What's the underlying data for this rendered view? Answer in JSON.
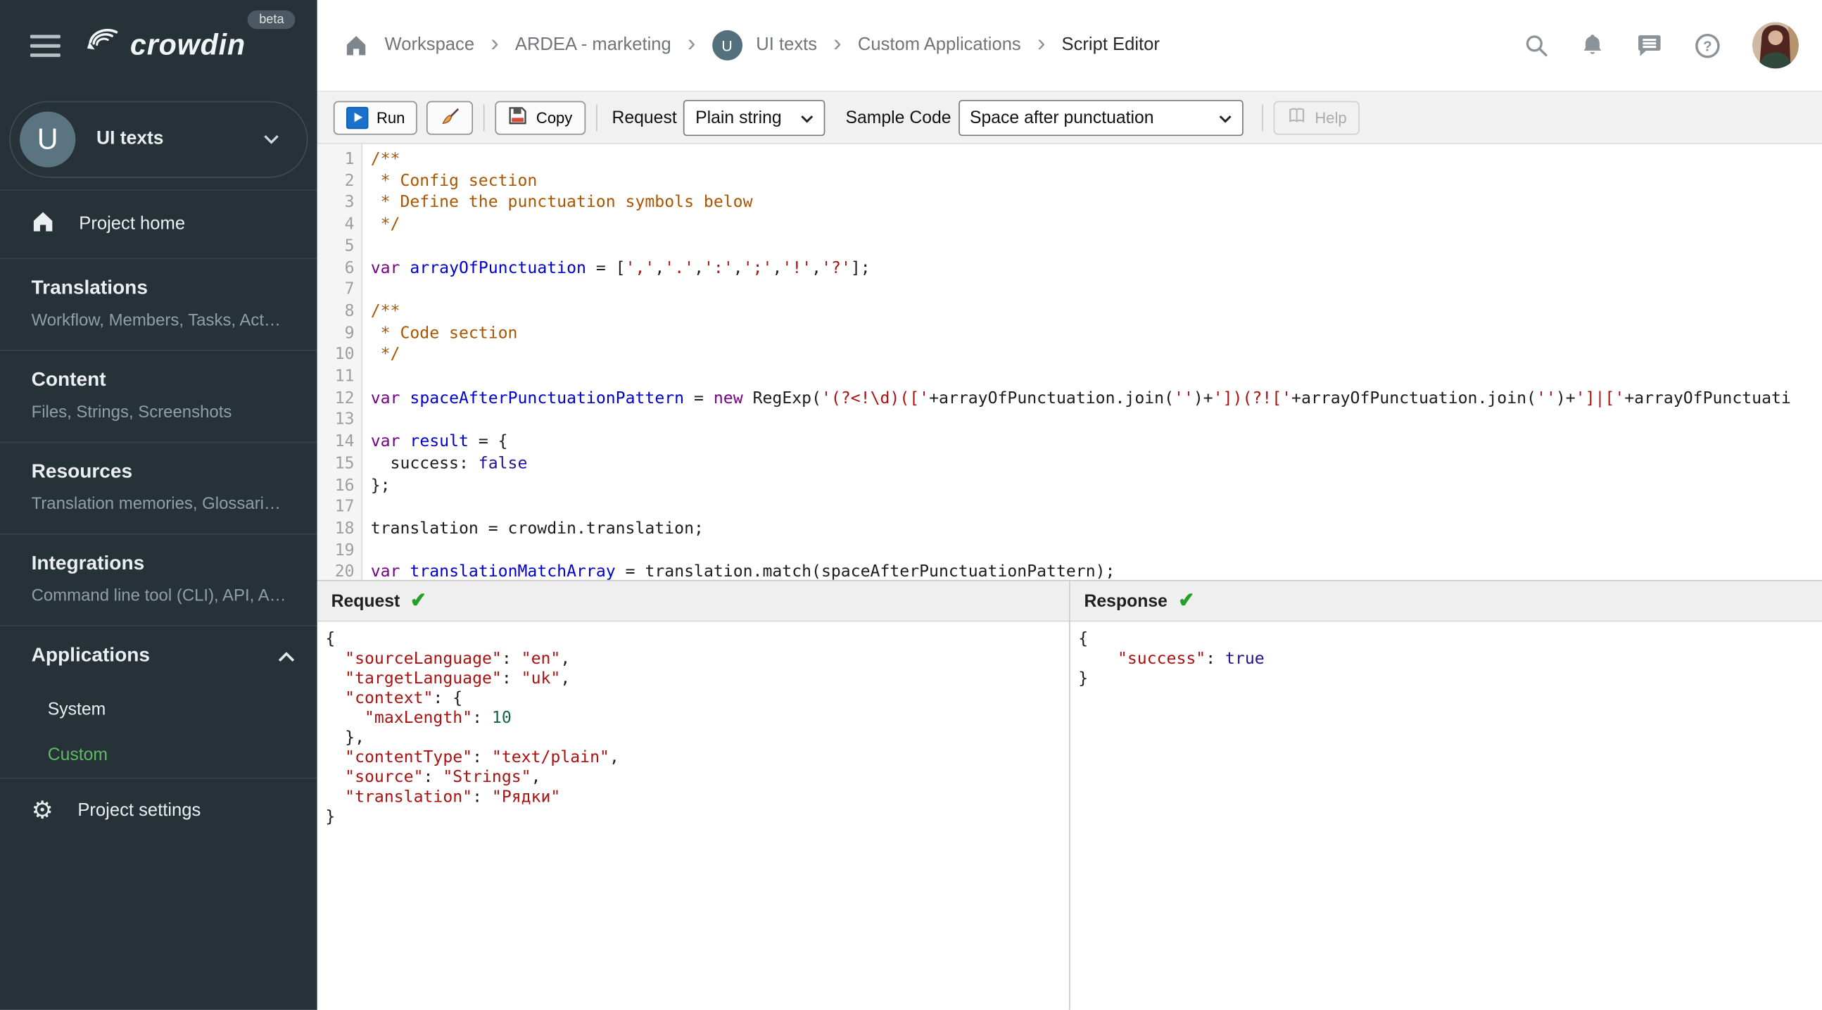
{
  "colors": {
    "sidebar_bg": "#263238",
    "sidebar_muted_text": "#8da0a9",
    "active_green": "#5fba65",
    "check_green": "#23a127",
    "run_icon_blue": "#1a72cd",
    "code_comment": "#aa5500",
    "code_keyword": "#770088",
    "code_def": "#0000cc",
    "code_string": "#aa1111",
    "code_number": "#116644",
    "code_atom": "#221199"
  },
  "topbar": {
    "logo_text": "crowdin",
    "beta_badge": "beta",
    "project_initial": "U",
    "breadcrumb": [
      "Workspace",
      "ARDEA - marketing",
      "UI texts",
      "Custom Applications",
      "Script Editor"
    ]
  },
  "sidebar": {
    "project": {
      "initial": "U",
      "name": "UI texts"
    },
    "home_label": "Project home",
    "sections": [
      {
        "title": "Translations",
        "subtitle": "Workflow, Members, Tasks, Act…"
      },
      {
        "title": "Content",
        "subtitle": "Files, Strings, Screenshots"
      },
      {
        "title": "Resources",
        "subtitle": "Translation memories, Glossari…"
      },
      {
        "title": "Integrations",
        "subtitle": "Command line tool (CLI), API, A…"
      }
    ],
    "applications": {
      "title": "Applications",
      "items": [
        {
          "label": "System"
        },
        {
          "label": "Custom"
        }
      ],
      "active_item": "Custom"
    },
    "settings_label": "Project settings"
  },
  "toolbar": {
    "run_label": "Run",
    "copy_label": "Copy",
    "request_label": "Request",
    "request_value": "Plain string",
    "sample_code_label": "Sample Code",
    "sample_code_value": "Space after punctuation",
    "help_label": "Help"
  },
  "editor": {
    "lines": [
      {
        "tokens": [
          [
            "c",
            "/**"
          ]
        ]
      },
      {
        "tokens": [
          [
            "c",
            " * Config section"
          ]
        ]
      },
      {
        "tokens": [
          [
            "c",
            " * Define the punctuation symbols below"
          ]
        ]
      },
      {
        "tokens": [
          [
            "c",
            " */"
          ]
        ]
      },
      {
        "tokens": []
      },
      {
        "tokens": [
          [
            "k",
            "var"
          ],
          [
            "t",
            " "
          ],
          [
            "d",
            "arrayOfPunctuation"
          ],
          [
            "t",
            " = ["
          ],
          [
            "s",
            "','"
          ],
          [
            "t",
            ","
          ],
          [
            "s",
            "'.'"
          ],
          [
            "t",
            ","
          ],
          [
            "s",
            "':'"
          ],
          [
            "t",
            ","
          ],
          [
            "s",
            "';'"
          ],
          [
            "t",
            ","
          ],
          [
            "s",
            "'!'"
          ],
          [
            "t",
            ","
          ],
          [
            "s",
            "'?'"
          ],
          [
            "t",
            "];"
          ]
        ]
      },
      {
        "tokens": []
      },
      {
        "tokens": [
          [
            "c",
            "/**"
          ]
        ]
      },
      {
        "tokens": [
          [
            "c",
            " * Code section"
          ]
        ]
      },
      {
        "tokens": [
          [
            "c",
            " */"
          ]
        ]
      },
      {
        "tokens": []
      },
      {
        "tokens": [
          [
            "k",
            "var"
          ],
          [
            "t",
            " "
          ],
          [
            "d",
            "spaceAfterPunctuationPattern"
          ],
          [
            "t",
            " = "
          ],
          [
            "k",
            "new"
          ],
          [
            "t",
            " RegExp("
          ],
          [
            "s",
            "'(?<!\\d)(['"
          ],
          [
            "t",
            "+arrayOfPunctuation.join("
          ],
          [
            "s",
            "''"
          ],
          [
            "t",
            ")+"
          ],
          [
            "s",
            "'])(?!['"
          ],
          [
            "t",
            "+arrayOfPunctuation.join("
          ],
          [
            "s",
            "''"
          ],
          [
            "t",
            ")+"
          ],
          [
            "s",
            "']|['"
          ],
          [
            "t",
            "+arrayOfPunctuati"
          ]
        ]
      },
      {
        "tokens": []
      },
      {
        "tokens": [
          [
            "k",
            "var"
          ],
          [
            "t",
            " "
          ],
          [
            "d",
            "result"
          ],
          [
            "t",
            " = {"
          ]
        ]
      },
      {
        "tokens": [
          [
            "t",
            "  success: "
          ],
          [
            "a",
            "false"
          ]
        ]
      },
      {
        "tokens": [
          [
            "t",
            "};"
          ]
        ]
      },
      {
        "tokens": []
      },
      {
        "tokens": [
          [
            "t",
            "translation = crowdin.translation;"
          ]
        ]
      },
      {
        "tokens": []
      },
      {
        "tokens": [
          [
            "k",
            "var"
          ],
          [
            "t",
            " "
          ],
          [
            "d",
            "translationMatchArray"
          ],
          [
            "t",
            " = translation.match(spaceAfterPunctuationPattern);"
          ]
        ]
      },
      {
        "tokens": []
      }
    ]
  },
  "request_panel": {
    "title": "Request",
    "status": "success",
    "lines": [
      {
        "tokens": [
          [
            "t",
            "{"
          ]
        ]
      },
      {
        "tokens": [
          [
            "t",
            "  "
          ],
          [
            "s",
            "\"sourceLanguage\""
          ],
          [
            "t",
            ": "
          ],
          [
            "s",
            "\"en\""
          ],
          [
            "t",
            ","
          ]
        ]
      },
      {
        "tokens": [
          [
            "t",
            "  "
          ],
          [
            "s",
            "\"targetLanguage\""
          ],
          [
            "t",
            ": "
          ],
          [
            "s",
            "\"uk\""
          ],
          [
            "t",
            ","
          ]
        ]
      },
      {
        "tokens": [
          [
            "t",
            "  "
          ],
          [
            "s",
            "\"context\""
          ],
          [
            "t",
            ": {"
          ]
        ]
      },
      {
        "tokens": [
          [
            "t",
            "    "
          ],
          [
            "s",
            "\"maxLength\""
          ],
          [
            "t",
            ": "
          ],
          [
            "n",
            "10"
          ]
        ]
      },
      {
        "tokens": [
          [
            "t",
            "  },"
          ]
        ]
      },
      {
        "tokens": [
          [
            "t",
            "  "
          ],
          [
            "s",
            "\"contentType\""
          ],
          [
            "t",
            ": "
          ],
          [
            "s",
            "\"text/plain\""
          ],
          [
            "t",
            ","
          ]
        ]
      },
      {
        "tokens": [
          [
            "t",
            "  "
          ],
          [
            "s",
            "\"source\""
          ],
          [
            "t",
            ": "
          ],
          [
            "s",
            "\"Strings\""
          ],
          [
            "t",
            ","
          ]
        ]
      },
      {
        "tokens": [
          [
            "t",
            "  "
          ],
          [
            "s",
            "\"translation\""
          ],
          [
            "t",
            ": "
          ],
          [
            "s",
            "\"Рядки\""
          ]
        ]
      },
      {
        "tokens": [
          [
            "t",
            "}"
          ]
        ]
      }
    ]
  },
  "response_panel": {
    "title": "Response",
    "status": "success",
    "lines": [
      {
        "tokens": [
          [
            "t",
            "{"
          ]
        ]
      },
      {
        "tokens": [
          [
            "t",
            "    "
          ],
          [
            "s",
            "\"success\""
          ],
          [
            "t",
            ": "
          ],
          [
            "a",
            "true"
          ]
        ]
      },
      {
        "tokens": [
          [
            "t",
            "}"
          ]
        ]
      }
    ]
  }
}
